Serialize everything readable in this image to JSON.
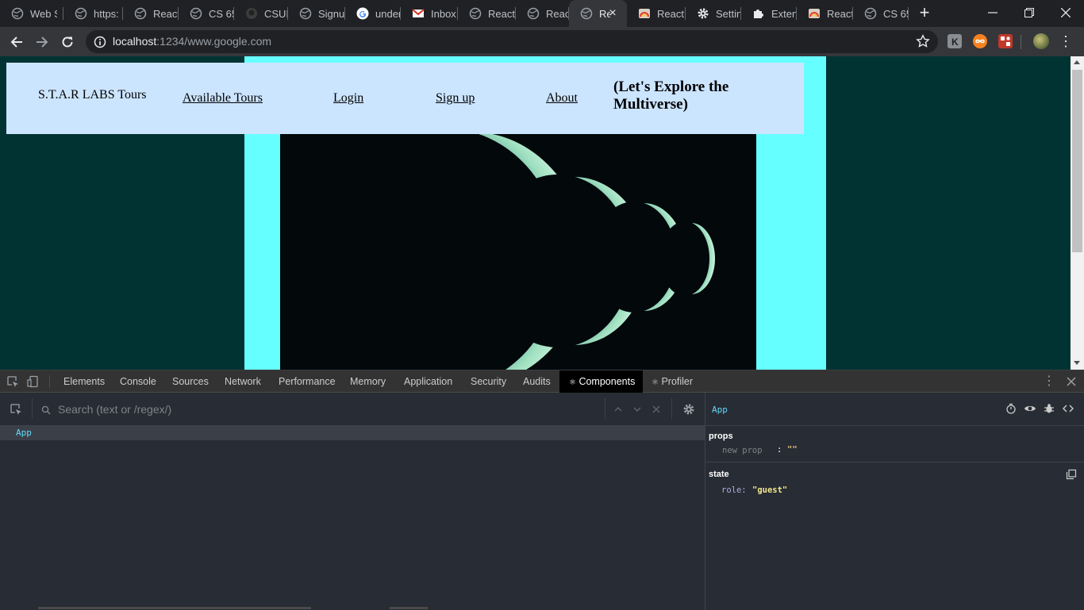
{
  "browser": {
    "tabs": [
      {
        "title": "Web S",
        "icon": "globe-icon"
      },
      {
        "title": "https:",
        "icon": "globe-icon"
      },
      {
        "title": "React",
        "icon": "globe-icon"
      },
      {
        "title": "CS 65",
        "icon": "globe-icon"
      },
      {
        "title": "CSUEI",
        "icon": "github-icon"
      },
      {
        "title": "Signu",
        "icon": "globe-icon"
      },
      {
        "title": "under",
        "icon": "google-icon"
      },
      {
        "title": "Inbox",
        "icon": "gmail-icon"
      },
      {
        "title": "React",
        "icon": "globe-icon"
      },
      {
        "title": "React",
        "icon": "globe-icon"
      },
      {
        "title": "Re",
        "icon": "globe-icon",
        "active": true
      },
      {
        "title": "React",
        "icon": "rainbow-icon"
      },
      {
        "title": "Settin",
        "icon": "gear-icon"
      },
      {
        "title": "Exten",
        "icon": "puzzle-icon"
      },
      {
        "title": "React",
        "icon": "rainbow-icon"
      },
      {
        "title": "CS 65",
        "icon": "globe-icon"
      }
    ],
    "url_host": "localhost",
    "url_path": ":1234/www.google.com"
  },
  "page": {
    "brand": "S.T.A.R LABS Tours",
    "nav": {
      "tours": "Available Tours",
      "login": "Login",
      "signup": "Sign up",
      "about": "About"
    },
    "tagline": "(Let's Explore the Multiverse)",
    "colors": {
      "background": "#023333",
      "content": "#66ffff",
      "navbar": "#cce5ff"
    }
  },
  "devtools": {
    "tabs": {
      "elements": "Elements",
      "console": "Console",
      "sources": "Sources",
      "network": "Network",
      "performance": "Performance",
      "memory": "Memory",
      "application": "Application",
      "security": "Security",
      "audits": "Audits",
      "components": "Components",
      "profiler": "Profiler"
    },
    "search_placeholder": "Search (text or /regex/)",
    "tree_item": "App",
    "selected_component": "App",
    "props_title": "props",
    "new_prop": "new prop",
    "new_prop_value": "\"\"",
    "state_title": "state",
    "state_key": "role",
    "state_value": "\"guest\""
  }
}
